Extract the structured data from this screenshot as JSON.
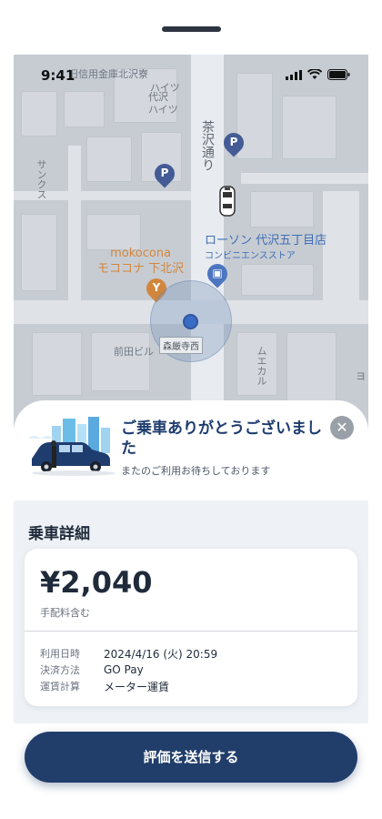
{
  "status_bar": {
    "time": "9:41"
  },
  "map": {
    "labels": {
      "street_top": "旧信用金庫北沢寮",
      "haitsu_1": "ハイツ",
      "haitsu_2": "代沢\nハイツ",
      "avenue": "茶沢通り",
      "sunks": "サンクス",
      "maeda": "前田ビル",
      "area_right": "ムエカル",
      "area_right2": "ヨ"
    },
    "place_orange": {
      "line1": "mokocona",
      "line2": "モココナ 下北沢"
    },
    "place_blue": {
      "line1": "ローソン 代沢五丁目店",
      "line2": "コンビニエンスストア"
    },
    "stop_label": "森厳寺西"
  },
  "thanks_card": {
    "title": "ご乗車ありがとうございました",
    "subtitle": "またのご利用お待ちしております"
  },
  "details": {
    "heading": "乗車詳細",
    "price": "¥2,040",
    "fee_note": "手配料含む",
    "rows": [
      {
        "key": "利用日時",
        "value": "2024/4/16 (火) 20:59"
      },
      {
        "key": "決済方法",
        "value": "GO Pay"
      },
      {
        "key": "運賃計算",
        "value": "メーター運賃"
      }
    ]
  },
  "submit_button": {
    "label": "評価を送信する"
  },
  "colors": {
    "primary": "#213e6b",
    "title": "#1e3c6e",
    "orange_place": "#d2863c",
    "blue_place": "#3f6fb6"
  }
}
